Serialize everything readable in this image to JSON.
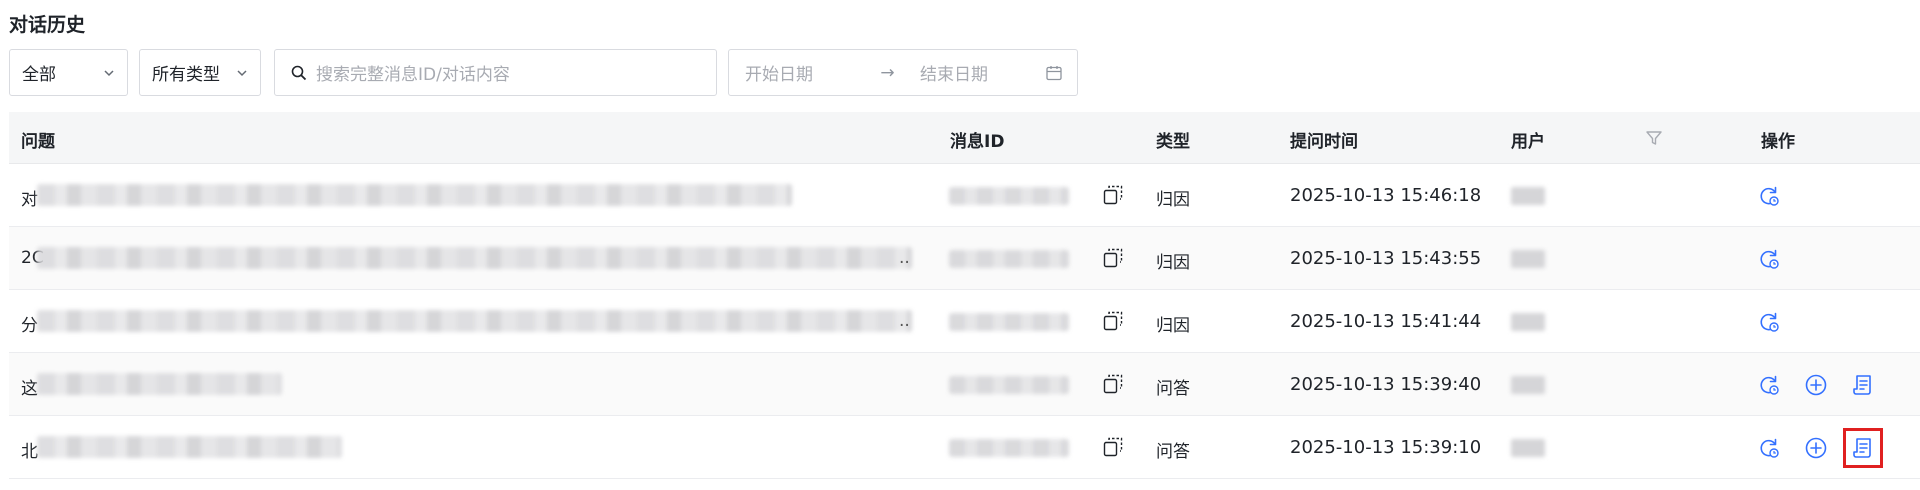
{
  "page": {
    "title": "对话历史"
  },
  "filters": {
    "scope_select": "全部",
    "type_select": "所有类型",
    "search_placeholder": "搜索完整消息ID/对话内容",
    "date_start_placeholder": "开始日期",
    "date_arrow": "→",
    "date_end_placeholder": "结束日期"
  },
  "table": {
    "headers": {
      "question": "问题",
      "message_id": "消息ID",
      "type": "类型",
      "time": "提问时间",
      "user": "用户",
      "actions": "操作"
    },
    "rows": [
      {
        "q_first_char": "对",
        "type": "归因",
        "time": "2025-10-13 15:46:18",
        "ellipsis": "",
        "actions": [
          "refresh"
        ]
      },
      {
        "q_first_char": "2C",
        "type": "归因",
        "time": "2025-10-13 15:43:55",
        "ellipsis": "..",
        "actions": [
          "refresh"
        ]
      },
      {
        "q_first_char": "分",
        "type": "归因",
        "time": "2025-10-13 15:41:44",
        "ellipsis": "..",
        "actions": [
          "refresh"
        ]
      },
      {
        "q_first_char": "这",
        "type": "问答",
        "time": "2025-10-13 15:39:40",
        "ellipsis": "",
        "actions": [
          "refresh",
          "add",
          "report"
        ]
      },
      {
        "q_first_char": "北",
        "type": "问答",
        "time": "2025-10-13 15:39:10",
        "ellipsis": "",
        "actions": [
          "refresh",
          "add",
          "report"
        ]
      }
    ]
  },
  "colors": {
    "accent": "#3370ff",
    "highlight": "#e02020"
  },
  "icons": [
    "chevron-down-icon",
    "search-icon",
    "calendar-icon",
    "filter-icon",
    "copy-icon",
    "refresh-icon",
    "add-icon",
    "report-icon"
  ]
}
